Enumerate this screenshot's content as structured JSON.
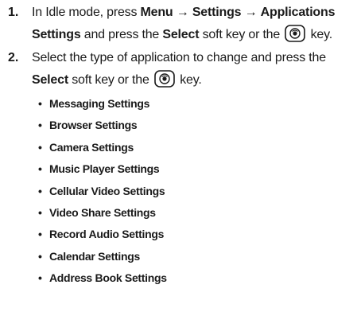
{
  "steps": [
    {
      "number": "1.",
      "line1": {
        "pre": "In Idle mode, press ",
        "menu": "Menu",
        "arrow1": "→",
        "settings": "Settings",
        "arrow2": "→",
        "applications": "Applications"
      },
      "line2": {
        "settings": "Settings",
        "mid": " and press the ",
        "select": "Select",
        "post": " soft key or the",
        "end": "key."
      }
    },
    {
      "number": "2.",
      "line1": {
        "text": "Select the type of application to change and press the"
      },
      "line2": {
        "select": "Select",
        "post": " soft key or the",
        "end": "key."
      }
    }
  ],
  "bullet_glyph": "•",
  "applications": [
    "Messaging Settings",
    "Browser Settings",
    "Camera Settings",
    "Music Player Settings",
    "Cellular Video Settings",
    "Video Share Settings",
    "Record Audio Settings",
    "Calendar Settings",
    "Address Book Settings"
  ],
  "icons": {
    "select_key": "ok-key-icon"
  },
  "colors": {
    "text": "#1a1a1a",
    "background": "#ffffff"
  }
}
